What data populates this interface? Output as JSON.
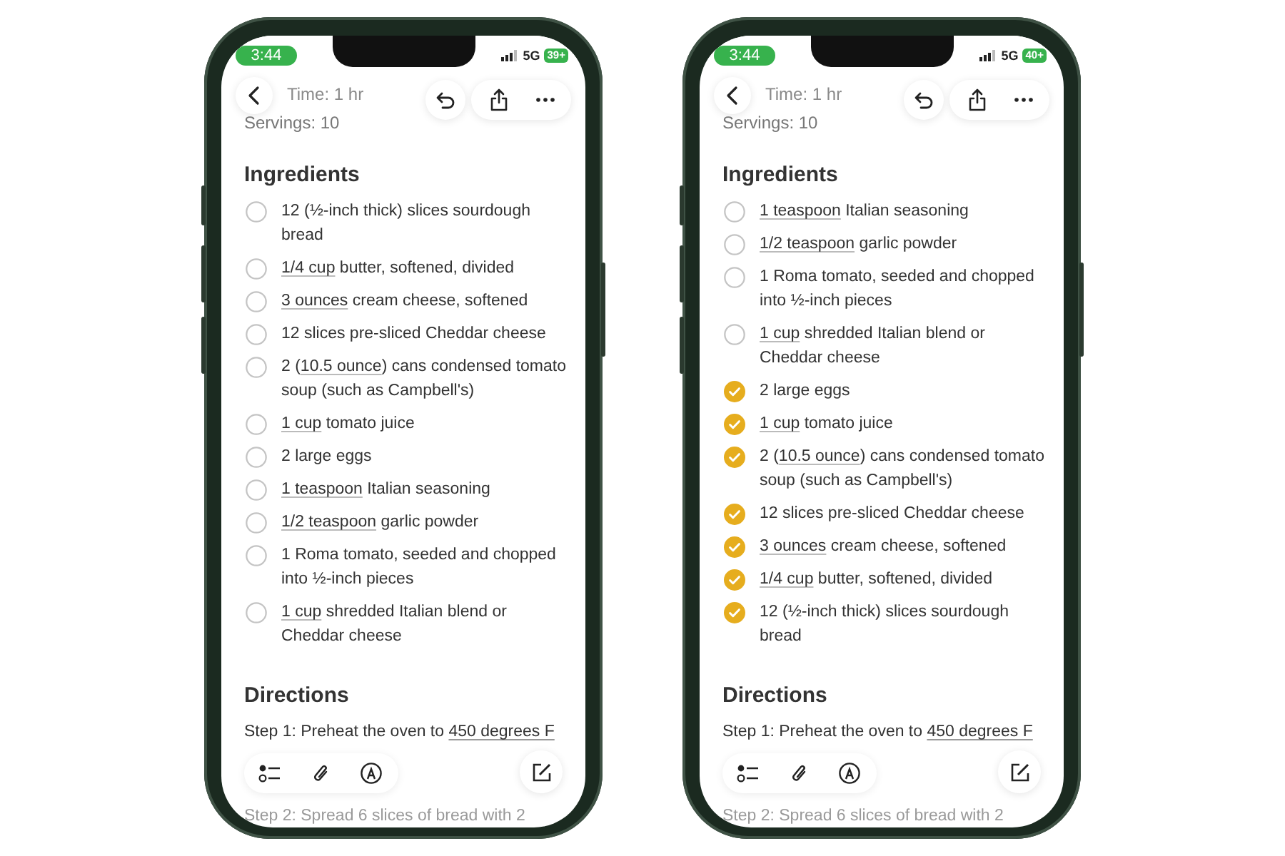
{
  "phones": [
    {
      "status": {
        "time": "3:44",
        "network": "5G",
        "battery": "39+"
      },
      "meta": [
        "Time: 1 hr",
        "Servings: 10"
      ],
      "ingredients_heading": "Ingredients",
      "ingredients": [
        {
          "checked": false,
          "segments": [
            {
              "text": "12 (½-inch thick) slices sourdough bread",
              "underline": false
            }
          ]
        },
        {
          "checked": false,
          "segments": [
            {
              "text": "1/4 cup",
              "underline": true
            },
            {
              "text": " butter, softened, divided",
              "underline": false
            }
          ]
        },
        {
          "checked": false,
          "segments": [
            {
              "text": "3 ounces",
              "underline": true
            },
            {
              "text": " cream cheese, softened",
              "underline": false
            }
          ]
        },
        {
          "checked": false,
          "segments": [
            {
              "text": "12 slices pre-sliced Cheddar cheese",
              "underline": false
            }
          ]
        },
        {
          "checked": false,
          "segments": [
            {
              "text": "2 (",
              "underline": false
            },
            {
              "text": "10.5 ounce",
              "underline": true
            },
            {
              "text": ") cans condensed tomato soup (such as Campbell's)",
              "underline": false
            }
          ]
        },
        {
          "checked": false,
          "segments": [
            {
              "text": "1 cup",
              "underline": true
            },
            {
              "text": " tomato juice",
              "underline": false
            }
          ]
        },
        {
          "checked": false,
          "segments": [
            {
              "text": "2 large eggs",
              "underline": false
            }
          ]
        },
        {
          "checked": false,
          "segments": [
            {
              "text": "1 teaspoon",
              "underline": true
            },
            {
              "text": " Italian seasoning",
              "underline": false
            }
          ]
        },
        {
          "checked": false,
          "segments": [
            {
              "text": "1/2 teaspoon",
              "underline": true
            },
            {
              "text": " garlic powder",
              "underline": false
            }
          ]
        },
        {
          "checked": false,
          "segments": [
            {
              "text": "1 Roma tomato, seeded and chopped into ½-inch pieces",
              "underline": false
            }
          ]
        },
        {
          "checked": false,
          "segments": [
            {
              "text": "1 cup",
              "underline": true
            },
            {
              "text": " shredded Italian blend or Cheddar cheese",
              "underline": false
            }
          ]
        }
      ],
      "directions_heading": "Directions",
      "steps": [
        {
          "segments": [
            {
              "text": "Step 1: Preheat the oven to ",
              "underline": false
            },
            {
              "text": "450 degrees F",
              "underline": true
            }
          ]
        },
        {
          "segments": [
            {
              "text": "Step 2: Spread 6 slices of bread with 2",
              "underline": false
            }
          ]
        }
      ]
    },
    {
      "status": {
        "time": "3:44",
        "network": "5G",
        "battery": "40+"
      },
      "meta": [
        "Time: 1 hr",
        "Servings: 10"
      ],
      "ingredients_heading": "Ingredients",
      "ingredients": [
        {
          "checked": false,
          "segments": [
            {
              "text": "1 teaspoon",
              "underline": true
            },
            {
              "text": " Italian seasoning",
              "underline": false
            }
          ]
        },
        {
          "checked": false,
          "segments": [
            {
              "text": "1/2 teaspoon",
              "underline": true
            },
            {
              "text": " garlic powder",
              "underline": false
            }
          ]
        },
        {
          "checked": false,
          "segments": [
            {
              "text": "1 Roma tomato, seeded and chopped into ½-inch pieces",
              "underline": false
            }
          ]
        },
        {
          "checked": false,
          "segments": [
            {
              "text": "1 cup",
              "underline": true
            },
            {
              "text": " shredded Italian blend or Cheddar cheese",
              "underline": false
            }
          ]
        },
        {
          "checked": true,
          "segments": [
            {
              "text": "2 large eggs",
              "underline": false
            }
          ]
        },
        {
          "checked": true,
          "segments": [
            {
              "text": "1 cup",
              "underline": true
            },
            {
              "text": " tomato juice",
              "underline": false
            }
          ]
        },
        {
          "checked": true,
          "segments": [
            {
              "text": "2 (",
              "underline": false
            },
            {
              "text": "10.5 ounce",
              "underline": true
            },
            {
              "text": ") cans condensed tomato soup (such as Campbell's)",
              "underline": false
            }
          ]
        },
        {
          "checked": true,
          "segments": [
            {
              "text": "12 slices pre-sliced Cheddar cheese",
              "underline": false
            }
          ]
        },
        {
          "checked": true,
          "segments": [
            {
              "text": "3 ounces",
              "underline": true
            },
            {
              "text": " cream cheese, softened",
              "underline": false
            }
          ]
        },
        {
          "checked": true,
          "segments": [
            {
              "text": "1/4 cup",
              "underline": true
            },
            {
              "text": " butter, softened, divided",
              "underline": false
            }
          ]
        },
        {
          "checked": true,
          "segments": [
            {
              "text": "12 (½-inch thick) slices sourdough bread",
              "underline": false
            }
          ]
        }
      ],
      "directions_heading": "Directions",
      "steps": [
        {
          "segments": [
            {
              "text": "Step 1: Preheat the oven to ",
              "underline": false
            },
            {
              "text": "450 degrees F",
              "underline": true
            }
          ]
        },
        {
          "segments": [
            {
              "text": "Step 2: Spread 6 slices of bread with 2",
              "underline": false
            }
          ]
        }
      ]
    }
  ]
}
